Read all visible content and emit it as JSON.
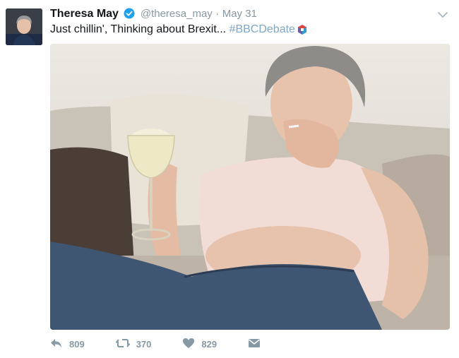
{
  "tweet": {
    "display_name": "Theresa May",
    "handle": "@theresa_may",
    "separator": "·",
    "date": "May 31",
    "text": "Just chillin', Thinking about Brexit... ",
    "hashtag": "#BBCDebate"
  },
  "actions": {
    "reply_count": "809",
    "retweet_count": "370",
    "like_count": "829"
  },
  "colors": {
    "verified": "#1da1f2",
    "hashtag": "#7fa7c9",
    "action_icon": "#8899a6"
  },
  "icons": [
    "verified-badge-icon",
    "chevron-down-icon",
    "reply-icon",
    "retweet-icon",
    "heart-icon",
    "direct-message-icon",
    "bbc-hashflag-icon"
  ]
}
